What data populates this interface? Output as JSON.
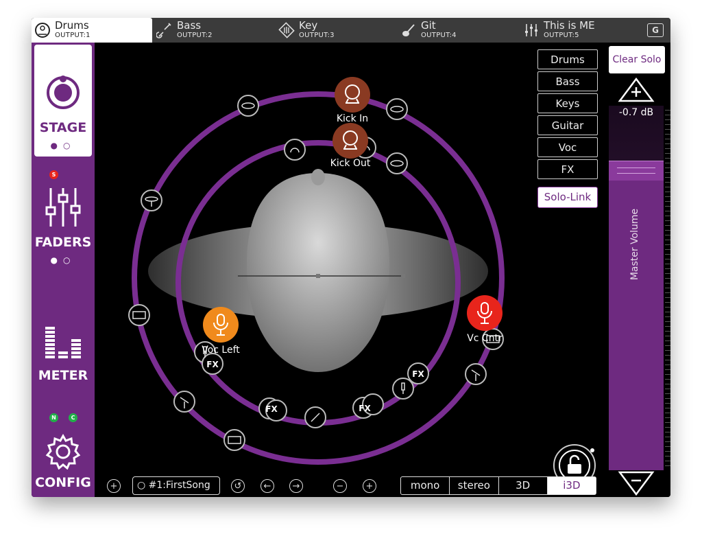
{
  "tabs": [
    {
      "name": "Drums",
      "output": "OUTPUT:1",
      "icon": "drummer-icon",
      "active": true
    },
    {
      "name": "Bass",
      "output": "OUTPUT:2",
      "icon": "bass-guitar-icon",
      "active": false
    },
    {
      "name": "Key",
      "output": "OUTPUT:3",
      "icon": "keyboard-icon",
      "active": false
    },
    {
      "name": "Git",
      "output": "OUTPUT:4",
      "icon": "guitar-icon",
      "active": false
    },
    {
      "name": "This is ME",
      "output": "OUTPUT:5",
      "icon": "mixer-icon",
      "active": false
    }
  ],
  "g_button": "G",
  "sidebar": {
    "stage": "STAGE",
    "faders": "FADERS",
    "meter": "METER",
    "config": "CONFIG",
    "solo_badge": "S",
    "badge_n": "N",
    "badge_c": "C"
  },
  "groups": [
    "Drums",
    "Bass",
    "Keys",
    "Guitar",
    "Voc",
    "FX"
  ],
  "solo_link": "Solo-Link",
  "clear_solo": "Clear Solo",
  "master": {
    "db": "-0.7 dB",
    "label": "Master Volume",
    "level": 0.85
  },
  "stage": {
    "channels": {
      "kick_in": "Kick In",
      "kick_out": "Kick Out",
      "voc_left": "Voc Left",
      "vc_cntr": "Vc Cntr"
    },
    "fx_label": "FX"
  },
  "bottom": {
    "song": "#1:FirstSong",
    "modes": [
      "mono",
      "stereo",
      "3D",
      "i3D"
    ],
    "active_mode": "i3D"
  },
  "colors": {
    "accent": "#6e2a80",
    "ring": "#7a2e92",
    "kick": "#8a3a22",
    "voc_left": "#f08a1c",
    "vc_cntr": "#e8251c"
  }
}
